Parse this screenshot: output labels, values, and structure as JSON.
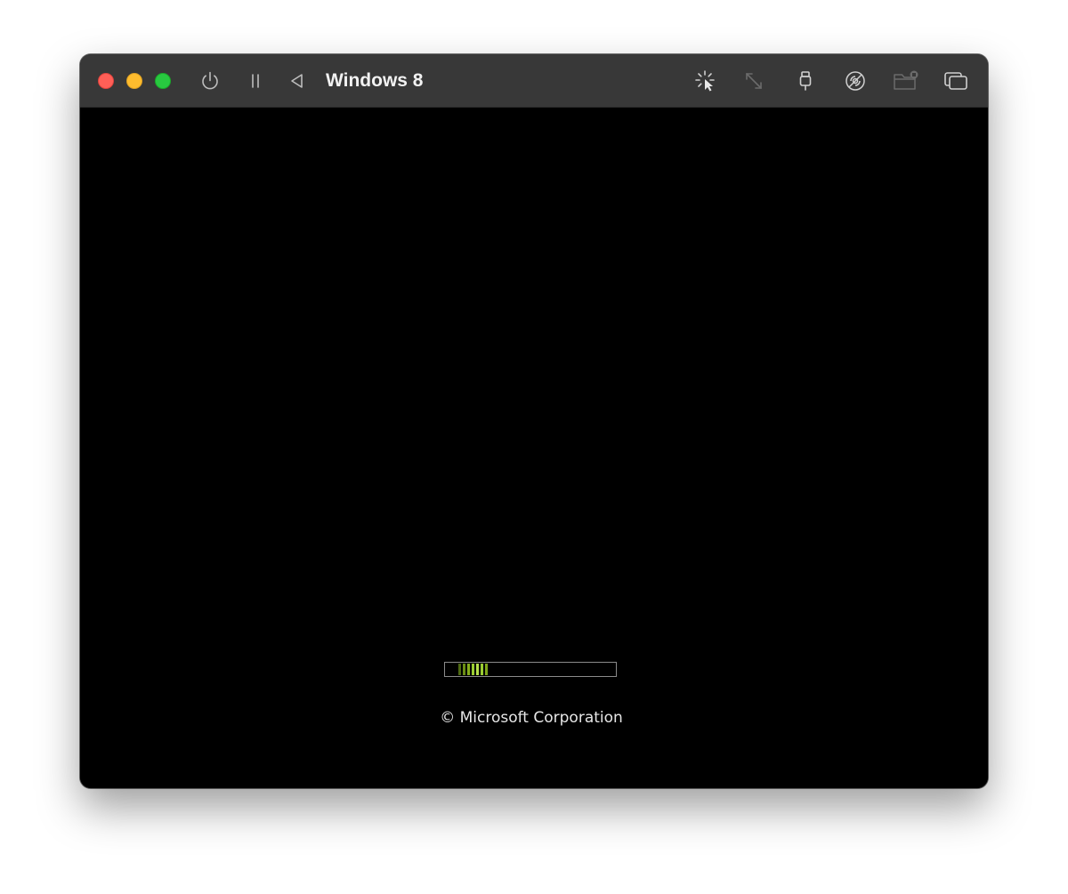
{
  "window": {
    "title": "Windows 8"
  },
  "traffic_lights": {
    "close_color": "#ff5f57",
    "minimize_color": "#febc2e",
    "maximize_color": "#28c840"
  },
  "toolbar": {
    "left_icons": [
      "power-icon",
      "pause-icon",
      "back-triangle-icon"
    ],
    "right_icons": [
      "capture-input-icon",
      "resize-arrows-icon",
      "usb-icon",
      "disc-icon",
      "shared-folder-icon",
      "windows-icon"
    ]
  },
  "boot_screen": {
    "progress_color": "#9acd32",
    "copyright": "© Microsoft Corporation"
  }
}
